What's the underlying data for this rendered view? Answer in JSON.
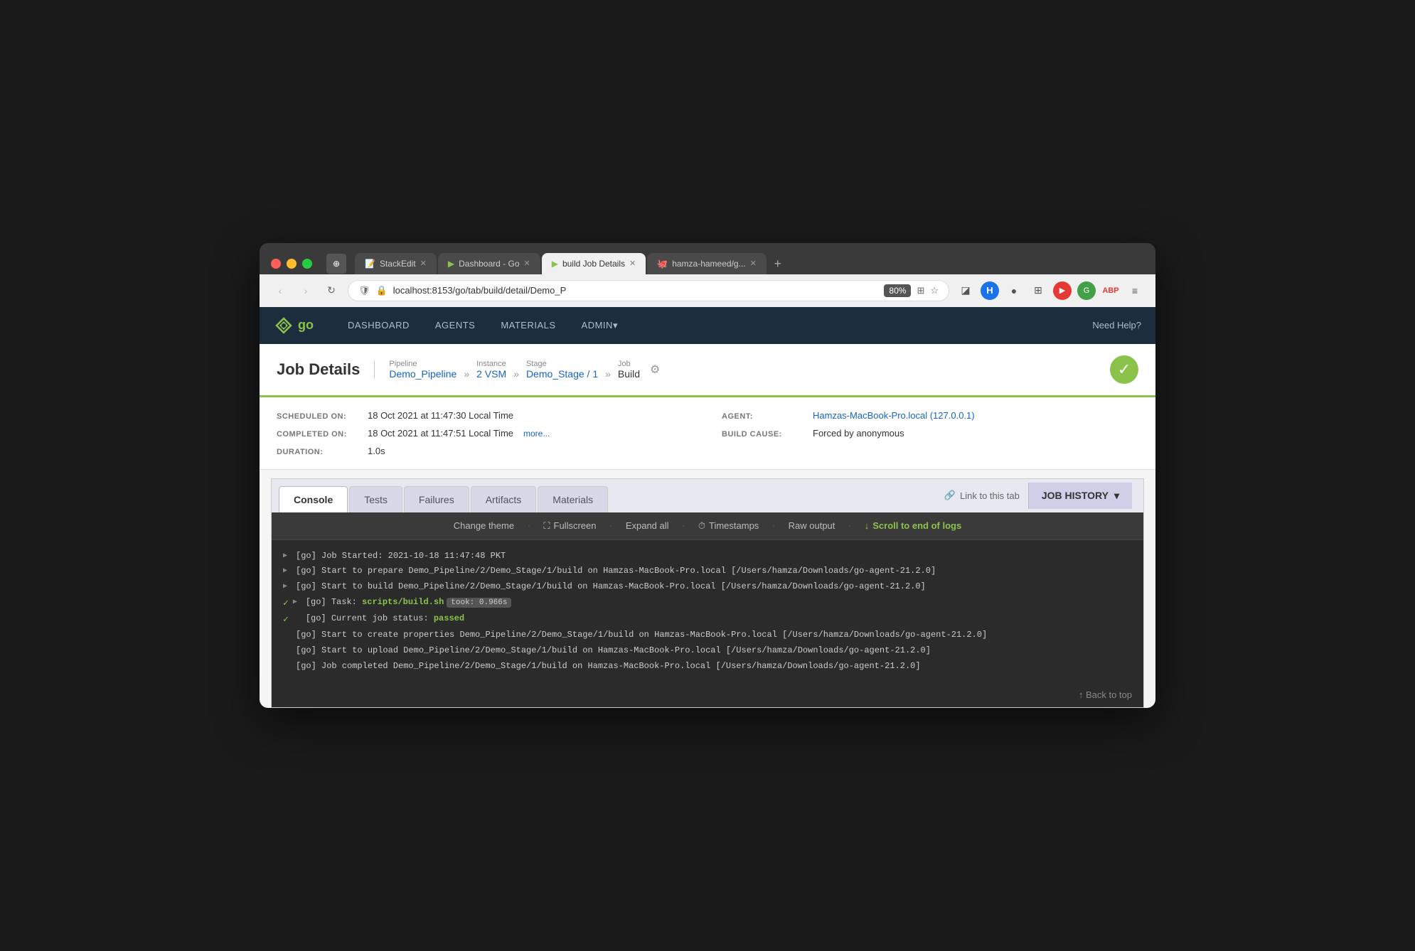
{
  "browser": {
    "tabs": [
      {
        "label": "StackEdit",
        "icon": "📝",
        "active": false
      },
      {
        "label": "Dashboard - Go",
        "icon": "▶",
        "active": false
      },
      {
        "label": "build Job Details",
        "icon": "▶",
        "active": true
      },
      {
        "label": "hamza-hameed/g...",
        "icon": "🐙",
        "active": false
      }
    ],
    "url": "localhost:8153/go/tab/build/detail/Demo_P",
    "zoom": "80%"
  },
  "nav": {
    "logo": "go",
    "links": [
      {
        "label": "DASHBOARD",
        "hasArrow": false
      },
      {
        "label": "AGENTS",
        "hasArrow": false
      },
      {
        "label": "MATERIALS",
        "hasArrow": false
      },
      {
        "label": "ADMIN",
        "hasArrow": true
      }
    ],
    "help": "Need Help?"
  },
  "job": {
    "title": "Job Details",
    "breadcrumb": {
      "pipeline_label": "Pipeline",
      "pipeline_value": "Demo_Pipeline",
      "instance_label": "Instance",
      "instance_value": "2 VSM",
      "stage_label": "Stage",
      "stage_value": "Demo_Stage / 1",
      "job_label": "Job",
      "job_value": "Build"
    },
    "status": "passed"
  },
  "meta": {
    "scheduled_label": "SCHEDULED ON:",
    "scheduled_value": "18 Oct 2021 at 11:47:30 Local Time",
    "completed_label": "COMPLETED ON:",
    "completed_value": "18 Oct 2021 at 11:47:51 Local Time",
    "completed_more": "more...",
    "duration_label": "DURATION:",
    "duration_value": "1.0s",
    "agent_label": "AGENT:",
    "agent_value": "Hamzas-MacBook-Pro.local (127.0.0.1)",
    "build_cause_label": "BUILD CAUSE:",
    "build_cause_value": "Forced by anonymous"
  },
  "tabs": {
    "items": [
      {
        "label": "Console",
        "active": true
      },
      {
        "label": "Tests",
        "active": false
      },
      {
        "label": "Failures",
        "active": false
      },
      {
        "label": "Artifacts",
        "active": false
      },
      {
        "label": "Materials",
        "active": false
      }
    ],
    "link_to_tab": "Link to this tab",
    "job_history": "JOB HISTORY"
  },
  "console": {
    "toolbar": {
      "change_theme": "Change theme",
      "fullscreen": "Fullscreen",
      "expand_all": "Expand all",
      "timestamps": "Timestamps",
      "raw_output": "Raw output",
      "scroll_to_end": "Scroll to end of logs"
    },
    "logs": [
      {
        "type": "expandable",
        "text": "[go] Job Started: 2021-10-18 11:47:48 PKT"
      },
      {
        "type": "expandable",
        "text": "[go] Start to prepare Demo_Pipeline/2/Demo_Stage/1/build on Hamzas-MacBook-Pro.local [/Users/hamza/Downloads/go-agent-21.2.0]"
      },
      {
        "type": "expandable",
        "text": "[go] Start to build Demo_Pipeline/2/Demo_Stage/1/build on Hamzas-MacBook-Pro.local [/Users/hamza/Downloads/go-agent-21.2.0]"
      },
      {
        "type": "task",
        "text": "[go] Task: ",
        "task_name": "scripts/build.sh",
        "took": "took: 0.966s"
      },
      {
        "type": "status",
        "text": "[go] Current job status: ",
        "status": "passed"
      },
      {
        "type": "plain",
        "text": "[go] Start to create properties Demo_Pipeline/2/Demo_Stage/1/build on Hamzas-MacBook-Pro.local [/Users/hamza/Downloads/go-agent-21.2.0]"
      },
      {
        "type": "plain",
        "text": "[go] Start to upload Demo_Pipeline/2/Demo_Stage/1/build on Hamzas-MacBook-Pro.local [/Users/hamza/Downloads/go-agent-21.2.0]"
      },
      {
        "type": "plain",
        "text": "[go] Job completed Demo_Pipeline/2/Demo_Stage/1/build on Hamzas-MacBook-Pro.local [/Users/hamza/Downloads/go-agent-21.2.0]"
      }
    ],
    "back_to_top": "↑ Back to top"
  }
}
